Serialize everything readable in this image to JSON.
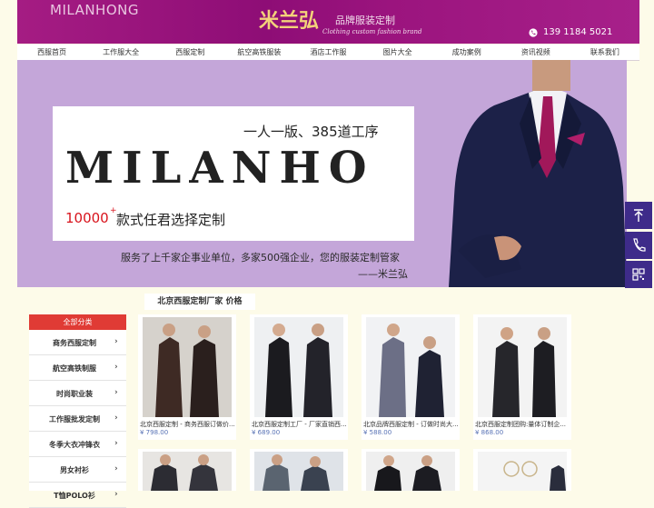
{
  "header": {
    "brand_en": "MILANHONG",
    "logo_cn": "米兰弘",
    "slogan": "品牌服装定制",
    "tagline": "Clothing custom fashion brand",
    "phone": "139 1184 5021"
  },
  "nav": {
    "items": [
      "西服首页",
      "工作服大全",
      "西服定制",
      "航空高铁服装",
      "酒店工作服",
      "图片大全",
      "成功案例",
      "资讯视频",
      "联系我们"
    ]
  },
  "banner": {
    "line1": "一人一版、385道工序",
    "main": "MILANHO",
    "number": "10000",
    "plus": "+",
    "desc": "款式任君选择定制",
    "sub": "服务了上千家企事业单位，多家500强企业，您的服装定制管家",
    "sign": "——米兰弘"
  },
  "section": {
    "title": "北京西服定制厂家 价格"
  },
  "sidebar": {
    "header": "全部分类",
    "items": [
      "商务西服定制",
      "航空高铁制服",
      "时尚职业装",
      "工作服批发定制",
      "冬季大衣冲锋衣",
      "男女衬衫",
      "T恤POLO衫"
    ]
  },
  "products": [
    {
      "name": "北京西服定制 - 商务西服订做价...",
      "price": "¥ 798.00"
    },
    {
      "name": "北京西服定制工厂 - 厂家直销西...",
      "price": "¥ 689.00"
    },
    {
      "name": "北京品牌西服定制 - 订做时尚大...",
      "price": "¥ 588.00"
    },
    {
      "name": "北京西服定制团购:量体订制企...",
      "price": "¥ 868.00"
    }
  ],
  "colors": {
    "header": "#9b147e",
    "nav_text": "#333333",
    "sidebar_head": "#e03b35",
    "side_tools": "#3e2b8a",
    "price": "#5872b5"
  }
}
